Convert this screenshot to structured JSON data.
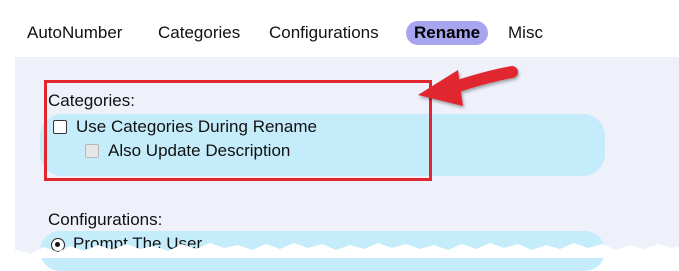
{
  "tabs": [
    {
      "label": "AutoNumber"
    },
    {
      "label": "Categories"
    },
    {
      "label": "Configurations"
    },
    {
      "label": "Rename",
      "active": true
    },
    {
      "label": "Misc"
    }
  ],
  "categories": {
    "header": "Categories:",
    "use_categories": {
      "label": "Use Categories During Rename",
      "checked": false
    },
    "also_update_description": {
      "label": "Also Update Description",
      "checked": false,
      "enabled": false
    }
  },
  "configurations": {
    "header": "Configurations:",
    "prompt_user": {
      "label": "Prompt The User",
      "selected": true
    }
  },
  "colors": {
    "accent_tab": "#a7a4f0",
    "group_background": "#c4ecfa",
    "callout_red": "#e0262e"
  }
}
